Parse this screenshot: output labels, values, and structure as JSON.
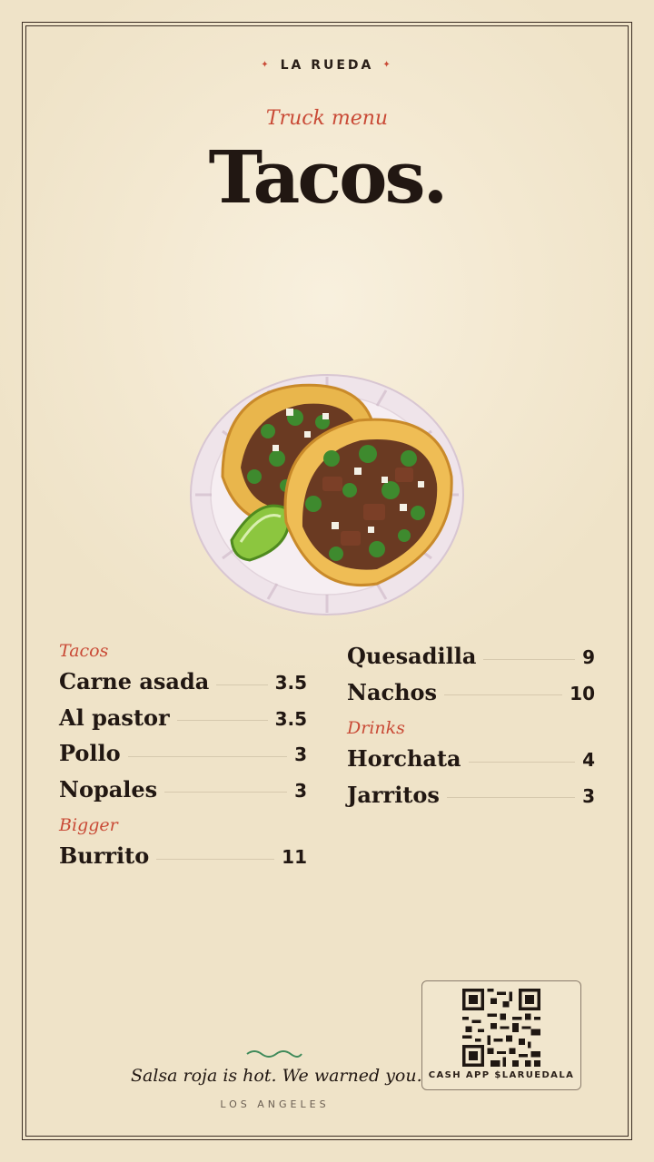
{
  "brand": "LA RUEDA",
  "brand_star": "✦",
  "subtitle": "Truck menu",
  "title": "Tacos.",
  "menu": {
    "left": [
      {
        "section": "Tacos",
        "items": [
          {
            "name": "Carne asada",
            "price": "3.5"
          },
          {
            "name": "Al pastor",
            "price": "3.5"
          },
          {
            "name": "Pollo",
            "price": "3"
          },
          {
            "name": "Nopales",
            "price": "3"
          }
        ]
      },
      {
        "section": "Bigger",
        "items": [
          {
            "name": "Burrito",
            "price": "11"
          }
        ]
      }
    ],
    "right_top": [
      {
        "name": "Quesadilla",
        "price": "9"
      },
      {
        "name": "Nachos",
        "price": "10"
      }
    ],
    "right": [
      {
        "section": "Drinks",
        "items": [
          {
            "name": "Horchata",
            "price": "4"
          },
          {
            "name": "Jarritos",
            "price": "3"
          }
        ]
      }
    ]
  },
  "tagline": "Salsa roja is hot. We warned you.",
  "city": "LOS ANGELES",
  "payment": {
    "label": "CASH APP $LARUEDALA"
  },
  "icons": {
    "plate": "tacos-plate-illustration",
    "qr": "qr-code-icon",
    "wave": "wave-divider-icon"
  },
  "colors": {
    "accent": "#c94a36",
    "ink": "#211712",
    "paper": "#f3e9d2",
    "wave": "#3f8a5a"
  }
}
